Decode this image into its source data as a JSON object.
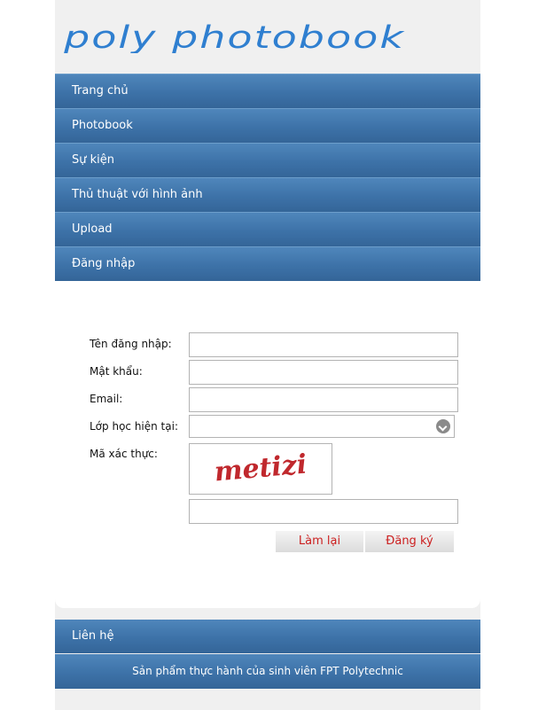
{
  "brand": {
    "logo_text": "poly photobook"
  },
  "nav": {
    "items": [
      {
        "label": "Trang chủ"
      },
      {
        "label": "Photobook"
      },
      {
        "label": "Sự kiện"
      },
      {
        "label": "Thủ thuật với hình ảnh"
      },
      {
        "label": "Upload"
      },
      {
        "label": "Đăng nhập"
      }
    ]
  },
  "form": {
    "username_label": "Tên đăng nhập:",
    "username_value": "",
    "password_label": "Mật khẩu:",
    "password_value": "",
    "email_label": "Email:",
    "email_value": "",
    "class_label": "Lớp học hiện tại:",
    "class_value": "",
    "captcha_label": "Mã xác thực:",
    "captcha_text": "metizi",
    "captcha_value": "",
    "reset_label": "Làm lại",
    "register_label": "Đăng ký"
  },
  "footer": {
    "contact_label": "Liên hệ",
    "credit_text": "Sản phẩm thực hành của sinh viên FPT Polytechnic"
  },
  "colors": {
    "nav_blue": "#3d72a8",
    "logo_blue": "#2f7fd0",
    "button_text": "#cc2020"
  }
}
